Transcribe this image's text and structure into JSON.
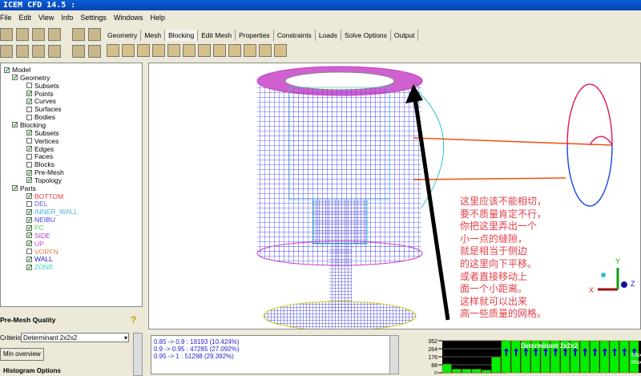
{
  "title": "ICEM CFD 14.5 :",
  "menu": [
    "File",
    "Edit",
    "View",
    "Info",
    "Settings",
    "Windows",
    "Help"
  ],
  "tabs": [
    "Geometry",
    "Mesh",
    "Blocking",
    "Edit Mesh",
    "Properties",
    "Constraints",
    "Loads",
    "Solve Options",
    "Output"
  ],
  "active_tab": "Blocking",
  "tree": [
    {
      "label": "Model",
      "level": 0,
      "checked": true,
      "color": "#000000"
    },
    {
      "label": "Geometry",
      "level": 1,
      "checked": true,
      "color": "#000000"
    },
    {
      "label": "Subsets",
      "level": 2,
      "checked": false,
      "color": "#000000"
    },
    {
      "label": "Points",
      "level": 2,
      "checked": true,
      "color": "#000000"
    },
    {
      "label": "Curves",
      "level": 2,
      "checked": true,
      "color": "#000000"
    },
    {
      "label": "Surfaces",
      "level": 2,
      "checked": false,
      "color": "#000000"
    },
    {
      "label": "Bodies",
      "level": 2,
      "checked": false,
      "color": "#000000"
    },
    {
      "label": "Blocking",
      "level": 1,
      "checked": true,
      "color": "#000000"
    },
    {
      "label": "Subsets",
      "level": 2,
      "checked": true,
      "color": "#000000"
    },
    {
      "label": "Vertices",
      "level": 2,
      "checked": false,
      "color": "#000000"
    },
    {
      "label": "Edges",
      "level": 2,
      "checked": true,
      "color": "#000000"
    },
    {
      "label": "Faces",
      "level": 2,
      "checked": false,
      "color": "#000000"
    },
    {
      "label": "Blocks",
      "level": 2,
      "checked": false,
      "color": "#000000"
    },
    {
      "label": "Pre-Mesh",
      "level": 2,
      "checked": true,
      "color": "#000000"
    },
    {
      "label": "Topology",
      "level": 2,
      "checked": true,
      "color": "#000000"
    },
    {
      "label": "Parts",
      "level": 1,
      "checked": true,
      "color": "#000000"
    },
    {
      "label": "BOTTOM",
      "level": 2,
      "checked": true,
      "color": "#e8404a"
    },
    {
      "label": "DEL",
      "level": 2,
      "checked": false,
      "color": "#6a5ae0"
    },
    {
      "label": "INNER_WALL",
      "level": 2,
      "checked": true,
      "color": "#50b0d8"
    },
    {
      "label": "NEIBU",
      "level": 2,
      "checked": true,
      "color": "#4040e0"
    },
    {
      "label": "PC",
      "level": 2,
      "checked": true,
      "color": "#50d050"
    },
    {
      "label": "SIDE",
      "level": 2,
      "checked": true,
      "color": "#b040d0"
    },
    {
      "label": "UP",
      "level": 2,
      "checked": true,
      "color": "#c050e0"
    },
    {
      "label": "VORFN",
      "level": 2,
      "checked": false,
      "color": "#e08040"
    },
    {
      "label": "WALL",
      "level": 2,
      "checked": true,
      "color": "#2020c0"
    },
    {
      "label": "ZONE",
      "level": 2,
      "checked": true,
      "color": "#40d0c0"
    }
  ],
  "premesh": {
    "heading": "Pre-Mesh Quality",
    "criterion_label": "Criterion",
    "criterion_value": "Determinant 2x2x2",
    "min_overview": "Min overview",
    "histogram_options": "Histogram Options"
  },
  "messages": [
    "0.85 -> 0.9 : 18193 (10.424%)",
    "0.9 -> 0.95 : 47285 (27.092%)",
    "0.95 -> 1 : 51298 (29.392%)"
  ],
  "annotation": [
    "这里应该不能相切，",
    "要不质量肯定不行，",
    "你把这里弄出一个",
    "小一点的缝隙，",
    "就是相当于侧边",
    "的这里向下平移。",
    "或者直接移动上",
    "面一个小距离。",
    "这样就可以出来",
    "高一些质量的网格。"
  ],
  "axes": {
    "x": "X",
    "y": "Y",
    "z": "Z"
  },
  "chart_data": {
    "type": "bar",
    "title": "Determinant 2x2x2",
    "yticks": [
      "352",
      "264",
      "176",
      "88",
      "0"
    ],
    "ylim": [
      0,
      352
    ],
    "values": [
      95,
      40,
      40,
      40,
      30,
      170,
      352,
      352,
      352,
      352,
      352,
      352,
      352,
      352,
      352,
      352,
      352,
      352,
      352,
      352
    ],
    "overflow": [
      false,
      false,
      false,
      false,
      false,
      false,
      true,
      true,
      true,
      true,
      true,
      true,
      true,
      true,
      true,
      true,
      true,
      true,
      true,
      true
    ],
    "side_labels": [
      "Max",
      "Max"
    ]
  },
  "colors": {
    "bar": "#00ee00",
    "arrow": "#0000cc",
    "annotation": "#e0404a"
  }
}
